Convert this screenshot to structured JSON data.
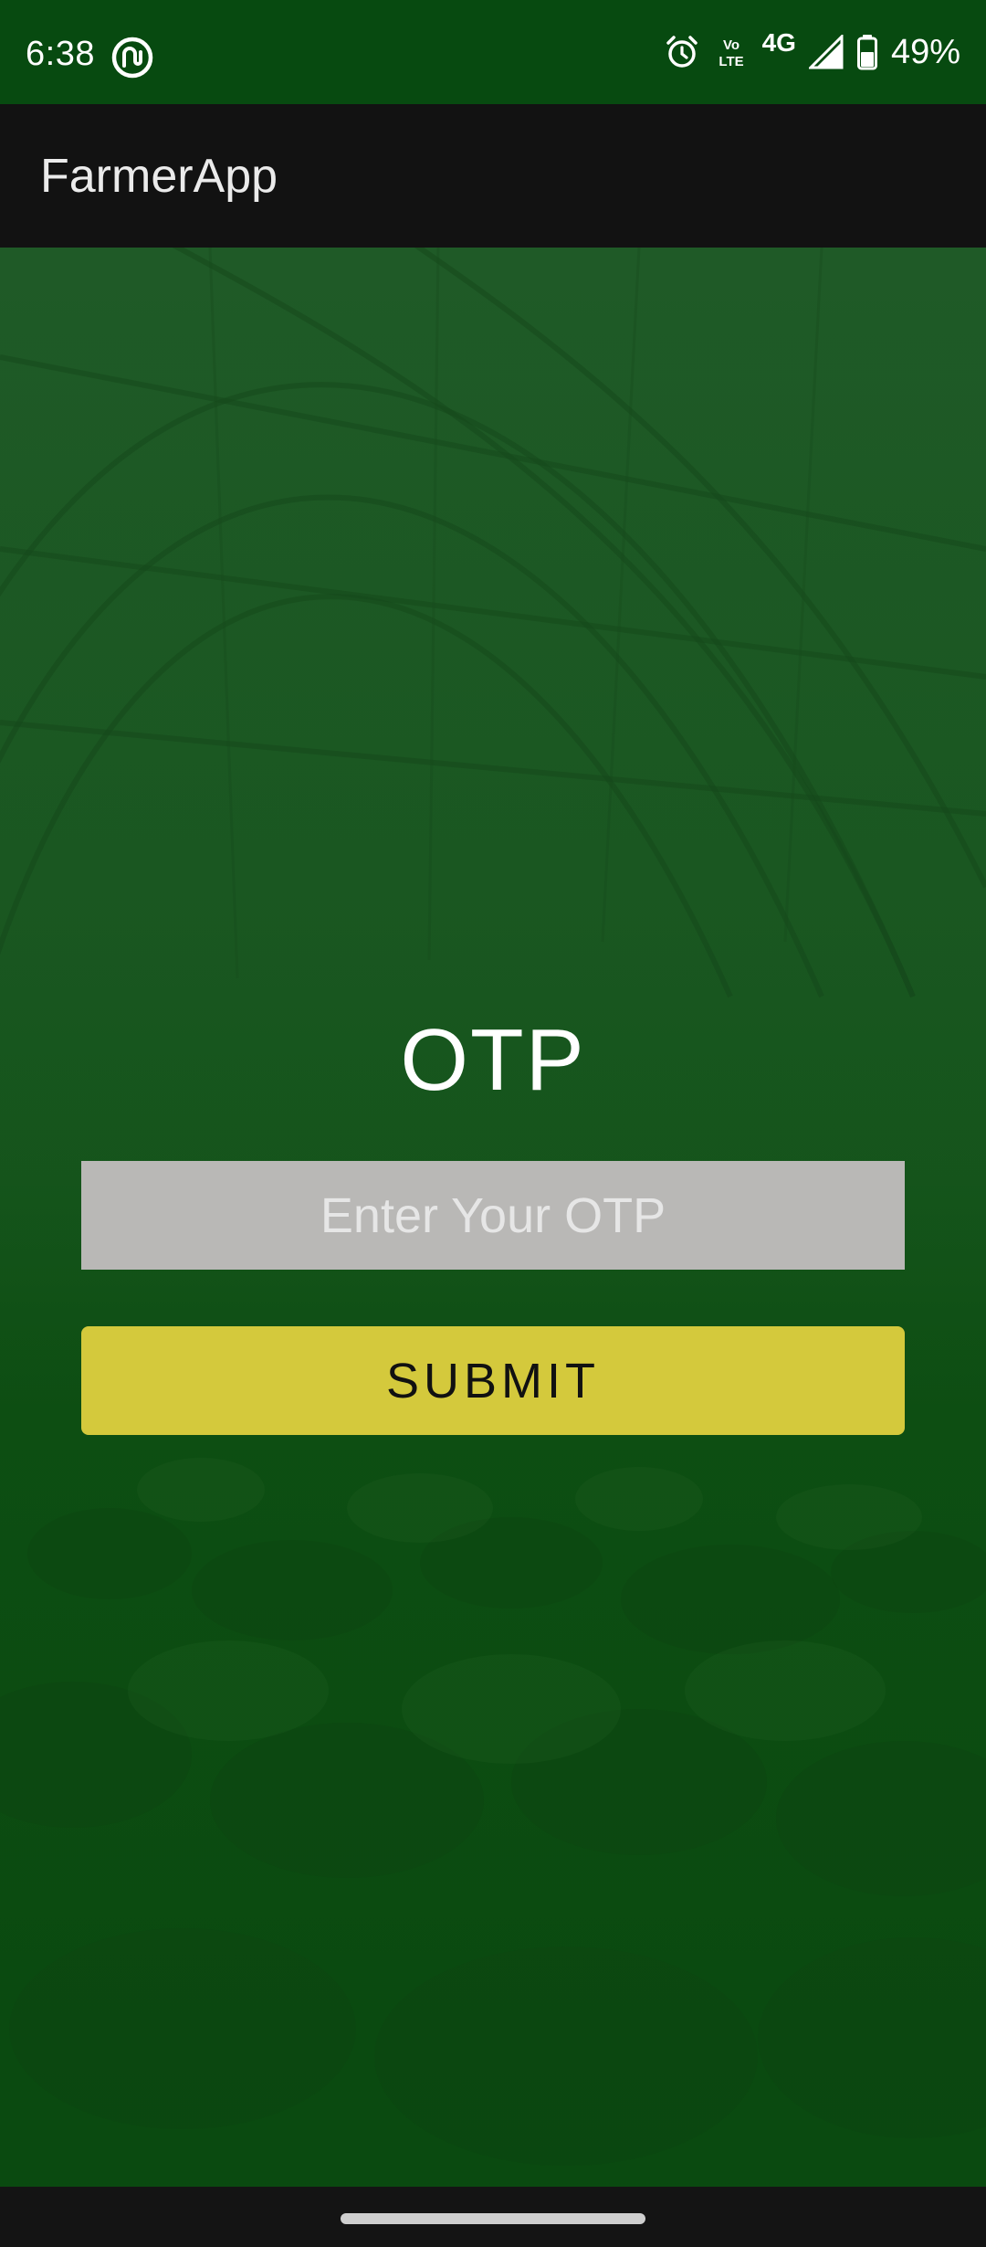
{
  "status_bar": {
    "time": "6:38",
    "app_icon": "loop-logo-icon",
    "icons": [
      "alarm-icon",
      "volte-icon",
      "4g-icon",
      "signal-icon",
      "battery-icon"
    ],
    "volte_top": "Vo",
    "volte_bottom": "LTE",
    "network": "4G",
    "battery_percent": "49%"
  },
  "app_bar": {
    "title": "FarmerApp"
  },
  "otp_screen": {
    "heading": "OTP",
    "input_value": "",
    "input_placeholder": "Enter Your OTP",
    "submit_label": "SUBMIT"
  },
  "colors": {
    "status_bar_bg": "#074a10",
    "app_bar_bg": "#121212",
    "background_green": "#1e5b25",
    "input_bg": "#b9b8b6",
    "button_bg": "#d4c93c",
    "nav_bar_bg": "#141414"
  }
}
